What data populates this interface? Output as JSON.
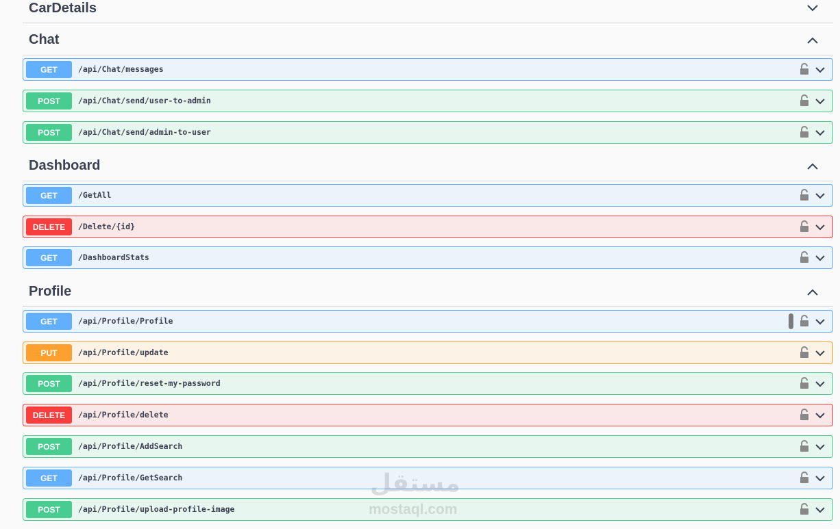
{
  "sections": {
    "cardetails": {
      "title": "CarDetails",
      "expanded": false
    },
    "chat": {
      "title": "Chat",
      "expanded": true
    },
    "dashboard": {
      "title": "Dashboard",
      "expanded": true
    },
    "profile": {
      "title": "Profile",
      "expanded": true
    }
  },
  "operations": [
    {
      "method": "GET",
      "path": "/api/Chat/messages"
    },
    {
      "method": "POST",
      "path": "/api/Chat/send/user-to-admin"
    },
    {
      "method": "POST",
      "path": "/api/Chat/send/admin-to-user"
    },
    {
      "method": "GET",
      "path": "/GetAll"
    },
    {
      "method": "DELETE",
      "path": "/Delete/{id}"
    },
    {
      "method": "GET",
      "path": "/DashboardStats"
    },
    {
      "method": "GET",
      "path": "/api/Profile/Profile"
    },
    {
      "method": "PUT",
      "path": "/api/Profile/update"
    },
    {
      "method": "POST",
      "path": "/api/Profile/reset-my-password"
    },
    {
      "method": "DELETE",
      "path": "/api/Profile/delete"
    },
    {
      "method": "POST",
      "path": "/api/Profile/AddSearch"
    },
    {
      "method": "GET",
      "path": "/api/Profile/GetSearch"
    },
    {
      "method": "POST",
      "path": "/api/Profile/upload-profile-image"
    }
  ],
  "colors": {
    "get": "#61affe",
    "post": "#49cc90",
    "delete": "#f93e3e",
    "put": "#fca130"
  },
  "watermark": {
    "arabic": "مستقل",
    "latin": "mostaql.com"
  }
}
